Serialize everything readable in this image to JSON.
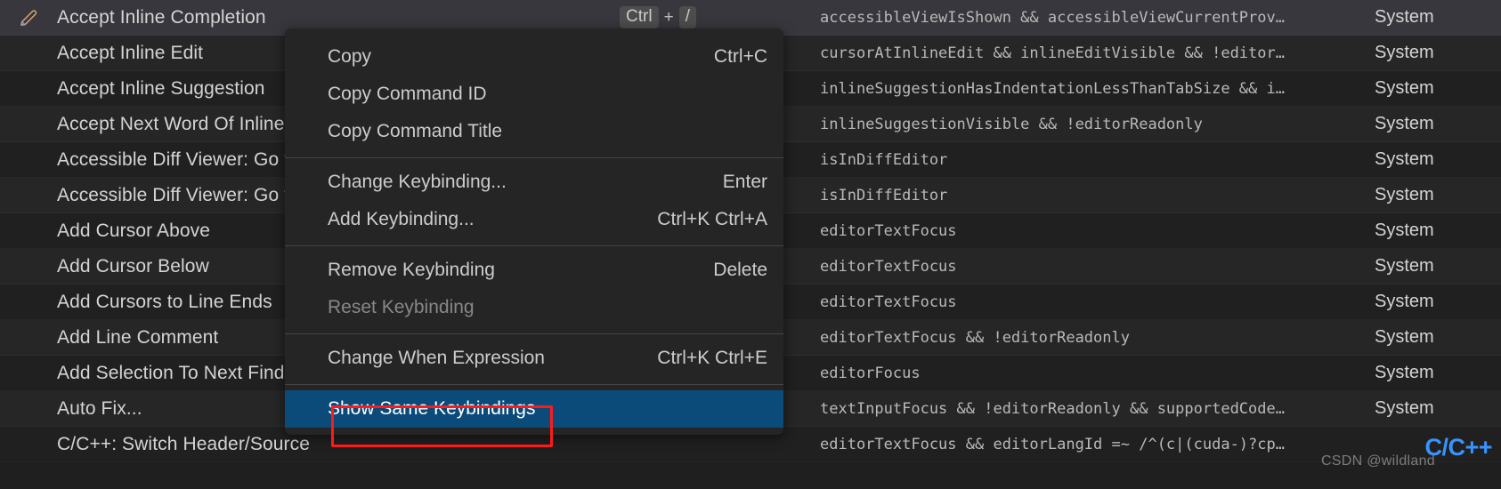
{
  "colors": {
    "background": "#1f1f1f",
    "row_odd": "#202020",
    "row_even": "#262626",
    "row_selected": "#37373d",
    "menu_background": "#252526",
    "menu_selected": "#0a4b7a",
    "annotation_outline": "#ff1a1a",
    "text_primary": "#cccccc",
    "text_disabled": "#888888",
    "lang_badge": "#3794ff"
  },
  "keybindings_table": {
    "rows": [
      {
        "icon": "pencil-icon",
        "command": "Accept Inline Completion",
        "keys": [
          "Ctrl",
          "/"
        ],
        "when": "accessibleViewIsShown && accessibleViewCurrentProv…",
        "source": "System",
        "selected": true
      },
      {
        "icon": "",
        "command": "Accept Inline Edit",
        "keys": [],
        "when": "cursorAtInlineEdit && inlineEditVisible && !editor…",
        "source": "System",
        "selected": false
      },
      {
        "icon": "",
        "command": "Accept Inline Suggestion",
        "keys": [],
        "when": "inlineSuggestionHasIndentationLessThanTabSize && i…",
        "source": "System",
        "selected": false
      },
      {
        "icon": "",
        "command": "Accept Next Word Of Inline Suggestion",
        "keys": [],
        "when": "inlineSuggestionVisible && !editorReadonly",
        "source": "System",
        "selected": false
      },
      {
        "icon": "",
        "command": "Accessible Diff Viewer: Go to Next Difference",
        "keys": [],
        "when": "isInDiffEditor",
        "source": "System",
        "selected": false
      },
      {
        "icon": "",
        "command": "Accessible Diff Viewer: Go to Previous Difference",
        "keys": [],
        "when": "isInDiffEditor",
        "source": "System",
        "selected": false
      },
      {
        "icon": "",
        "command": "Add Cursor Above",
        "keys": [],
        "when": "editorTextFocus",
        "source": "System",
        "selected": false
      },
      {
        "icon": "",
        "command": "Add Cursor Below",
        "keys": [],
        "when": "editorTextFocus",
        "source": "System",
        "selected": false
      },
      {
        "icon": "",
        "command": "Add Cursors to Line Ends",
        "keys": [],
        "when": "editorTextFocus",
        "source": "System",
        "selected": false
      },
      {
        "icon": "",
        "command": "Add Line Comment",
        "keys": [],
        "when": "editorTextFocus && !editorReadonly",
        "source": "System",
        "selected": false
      },
      {
        "icon": "",
        "command": "Add Selection To Next Find Match",
        "keys": [],
        "when": "editorFocus",
        "source": "System",
        "selected": false
      },
      {
        "icon": "",
        "command": "Auto Fix...",
        "keys": [],
        "when": "textInputFocus && !editorReadonly && supportedCode…",
        "source": "System",
        "selected": false
      },
      {
        "icon": "",
        "command": "C/C++: Switch Header/Source",
        "keys": [],
        "when": "editorTextFocus && editorLangId =~ /^(c|(cuda-)?cp…",
        "source": "",
        "lang_badge": "C/C++",
        "selected": false
      }
    ]
  },
  "context_menu": {
    "groups": [
      {
        "items": [
          {
            "label": "Copy",
            "accel": "Ctrl+C",
            "disabled": false,
            "selected": false
          },
          {
            "label": "Copy Command ID",
            "accel": "",
            "disabled": false,
            "selected": false
          },
          {
            "label": "Copy Command Title",
            "accel": "",
            "disabled": false,
            "selected": false
          }
        ]
      },
      {
        "items": [
          {
            "label": "Change Keybinding...",
            "accel": "Enter",
            "disabled": false,
            "selected": false
          },
          {
            "label": "Add Keybinding...",
            "accel": "Ctrl+K Ctrl+A",
            "disabled": false,
            "selected": false
          }
        ]
      },
      {
        "items": [
          {
            "label": "Remove Keybinding",
            "accel": "Delete",
            "disabled": false,
            "selected": false
          },
          {
            "label": "Reset Keybinding",
            "accel": "",
            "disabled": true,
            "selected": false
          }
        ]
      },
      {
        "items": [
          {
            "label": "Change When Expression",
            "accel": "Ctrl+K Ctrl+E",
            "disabled": false,
            "selected": false
          }
        ]
      },
      {
        "items": [
          {
            "label": "Show Same Keybindings",
            "accel": "",
            "disabled": false,
            "selected": true
          }
        ]
      }
    ]
  },
  "watermark": {
    "text": "CSDN @wildland"
  }
}
